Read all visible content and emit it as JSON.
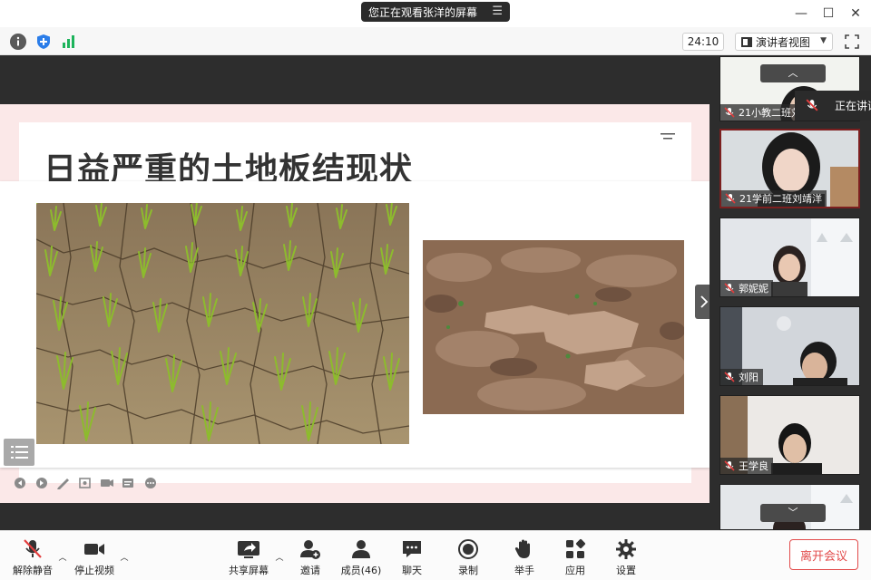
{
  "banner": {
    "text": "您正在观看张洋的屏幕",
    "menu_icon": "list-icon"
  },
  "window_controls": {
    "minimize": "—",
    "maximize": "☐",
    "close": "✕"
  },
  "toolbar": {
    "timer": "24:10",
    "view_mode": "演讲者视图",
    "icons": [
      "info-icon",
      "shield-icon",
      "signal-icon",
      "fullscreen-icon"
    ]
  },
  "slide": {
    "title": "日益严重的土地板结现状",
    "background_color": "#fbe8e8"
  },
  "gallery": {
    "speaking_label": "正在讲话",
    "participants": [
      {
        "name": "21小教二班刘"
      },
      {
        "name": "21学前二班刘靖洋"
      },
      {
        "name": "郭妮妮"
      },
      {
        "name": "刘阳"
      },
      {
        "name": "王学良"
      }
    ],
    "up_arrow": "︿",
    "down_arrow": "﹀"
  },
  "bottombar": {
    "mute": "解除静音",
    "video": "停止视频",
    "share": "共享屏幕",
    "invite": "邀请",
    "members": "成员(46)",
    "chat": "聊天",
    "record": "录制",
    "raise_hand": "举手",
    "apps": "应用",
    "settings": "设置",
    "leave": "离开会议",
    "leave_color": "#e24b4b"
  }
}
